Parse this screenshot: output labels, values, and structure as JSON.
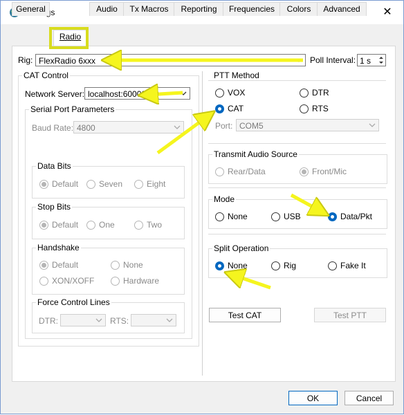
{
  "window": {
    "title": "Settings",
    "help": "?",
    "close": "✕"
  },
  "tabs": [
    {
      "label": "General"
    },
    {
      "label": "Radio"
    },
    {
      "label": "Audio"
    },
    {
      "label": "Tx Macros"
    },
    {
      "label": "Reporting"
    },
    {
      "label": "Frequencies"
    },
    {
      "label": "Colors"
    },
    {
      "label": "Advanced"
    }
  ],
  "rig": {
    "label": "Rig:",
    "value": "FlexRadio 6xxx",
    "poll_label": "Poll Interval:",
    "poll_value": "1 s"
  },
  "cat": {
    "title": "CAT Control",
    "network_label": "Network Server:",
    "network_value": "localhost:60000",
    "serial": {
      "title": "Serial Port Parameters",
      "baud_label": "Baud Rate:",
      "baud_value": "4800",
      "data_bits": {
        "title": "Data Bits",
        "opts": [
          "Default",
          "Seven",
          "Eight"
        ]
      },
      "stop_bits": {
        "title": "Stop Bits",
        "opts": [
          "Default",
          "One",
          "Two"
        ]
      },
      "handshake": {
        "title": "Handshake",
        "opts": [
          "Default",
          "None",
          "XON/XOFF",
          "Hardware"
        ]
      },
      "force": {
        "title": "Force Control Lines",
        "dtr": "DTR:",
        "rts": "RTS:"
      }
    }
  },
  "ptt": {
    "title": "PTT Method",
    "opts": [
      "VOX",
      "DTR",
      "CAT",
      "RTS"
    ],
    "port_label": "Port:",
    "port_value": "COM5"
  },
  "tx_audio": {
    "title": "Transmit Audio Source",
    "opts": [
      "Rear/Data",
      "Front/Mic"
    ]
  },
  "mode": {
    "title": "Mode",
    "opts": [
      "None",
      "USB",
      "Data/Pkt"
    ]
  },
  "split": {
    "title": "Split Operation",
    "opts": [
      "None",
      "Rig",
      "Fake It"
    ]
  },
  "buttons": {
    "test_cat": "Test CAT",
    "test_ptt": "Test PTT",
    "ok": "OK",
    "cancel": "Cancel"
  },
  "colors": {
    "accent": "#0067c0",
    "annotation": "#f5f51e",
    "highlight_box": "#d8dc1e"
  }
}
